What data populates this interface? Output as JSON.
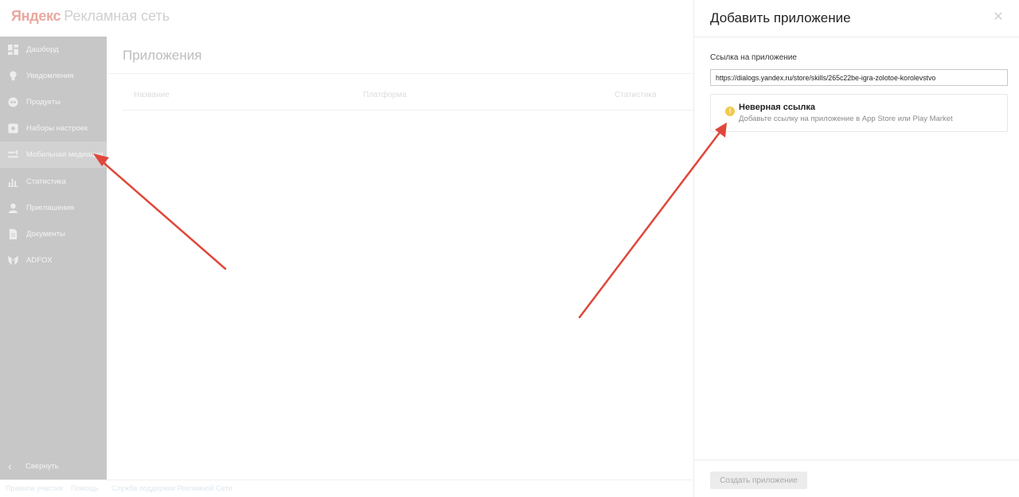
{
  "header": {
    "brand": "Яндекс",
    "product": "Рекламная сеть"
  },
  "sidebar": {
    "items": [
      {
        "label": "Дашборд",
        "icon": "dashboard-icon"
      },
      {
        "label": "Уведомления",
        "icon": "bulb-icon"
      },
      {
        "label": "Продукты",
        "icon": "products-icon"
      },
      {
        "label": "Наборы настроек",
        "icon": "settings-set-icon"
      },
      {
        "label": "Мобильная медиация",
        "icon": "mediation-icon",
        "active": true
      },
      {
        "label": "Статистика",
        "icon": "bar-chart-icon"
      },
      {
        "label": "Приглашения",
        "icon": "person-icon"
      },
      {
        "label": "Документы",
        "icon": "document-icon"
      },
      {
        "label": "ADFOX",
        "icon": "adfox-icon"
      }
    ],
    "collapse_label": "Свернуть"
  },
  "main": {
    "title": "Приложения",
    "columns": [
      "Название",
      "Платформа",
      "Статистика"
    ]
  },
  "footer": {
    "links": [
      "Правила участия",
      "Помощь",
      "Служба поддержки Рекламной Сети"
    ]
  },
  "panel": {
    "title": "Добавить приложение",
    "field_label": "Ссылка на приложение",
    "url_value": "https://dialogs.yandex.ru/store/skills/265c22be-igra-zolotoe-korolevstvo",
    "error": {
      "icon": "warning-icon",
      "title": "Неверная ссылка",
      "description": "Добавьте ссылку на приложение в App Store или Play Market"
    },
    "create_button": "Создать приложение"
  },
  "colors": {
    "annotation_arrow": "#e0473a",
    "sidebar_bg": "#c7c7c7",
    "warning": "#f2c94c"
  }
}
